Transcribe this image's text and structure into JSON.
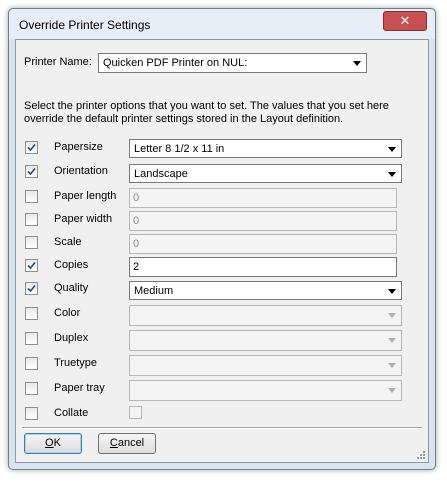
{
  "window": {
    "title": "Override Printer Settings",
    "close_glyph": "✕"
  },
  "printer": {
    "label": "Printer Name:",
    "value": "Quicken PDF Printer on NUL:"
  },
  "instructions": {
    "line1": "Select the printer options that you want to set. The values that you set here",
    "line2": "override the default printer settings stored in the Layout definition."
  },
  "options": {
    "papersize": {
      "label": "Papersize",
      "checked": true,
      "value": "Letter 8 1/2 x 11 in",
      "enabled": true,
      "control": "combo"
    },
    "orientation": {
      "label": "Orientation",
      "checked": true,
      "value": "Landscape",
      "enabled": true,
      "control": "combo"
    },
    "paper_length": {
      "label": "Paper length",
      "checked": false,
      "value": "0",
      "enabled": false,
      "control": "text"
    },
    "paper_width": {
      "label": "Paper width",
      "checked": false,
      "value": "0",
      "enabled": false,
      "control": "text"
    },
    "scale": {
      "label": "Scale",
      "checked": false,
      "value": "0",
      "enabled": false,
      "control": "text"
    },
    "copies": {
      "label": "Copies",
      "checked": true,
      "value": "2",
      "enabled": true,
      "control": "text"
    },
    "quality": {
      "label": "Quality",
      "checked": true,
      "value": "Medium",
      "enabled": true,
      "control": "combo"
    },
    "color": {
      "label": "Color",
      "checked": false,
      "value": "",
      "enabled": false,
      "control": "combo"
    },
    "duplex": {
      "label": "Duplex",
      "checked": false,
      "value": "",
      "enabled": false,
      "control": "combo"
    },
    "truetype": {
      "label": "Truetype",
      "checked": false,
      "value": "",
      "enabled": false,
      "control": "combo"
    },
    "paper_tray": {
      "label": "Paper tray",
      "checked": false,
      "value": "",
      "enabled": false,
      "control": "combo"
    },
    "collate": {
      "label": "Collate",
      "checked": false,
      "value_checked": false,
      "enabled": false,
      "control": "checkbox"
    }
  },
  "buttons": {
    "ok": {
      "label": "OK",
      "mnemonic": "O"
    },
    "cancel": {
      "label": "Cancel",
      "mnemonic": "C"
    }
  },
  "icons": {
    "check": "check-icon",
    "dropdown": "chevron-down-icon",
    "close": "close-icon",
    "grip": "resize-grip-icon"
  }
}
